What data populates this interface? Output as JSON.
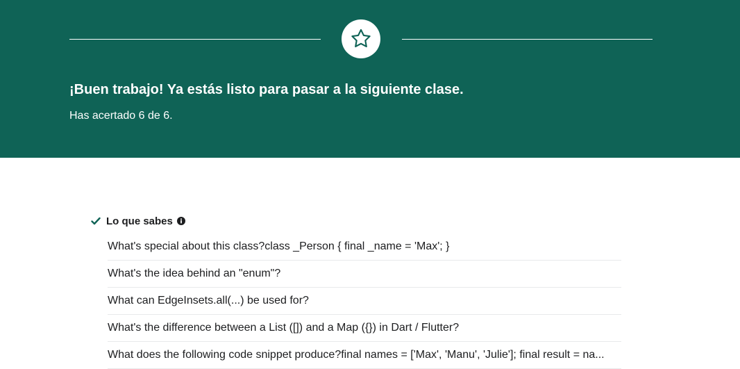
{
  "banner": {
    "headline": "¡Buen trabajo! Ya estás listo para pasar a la siguiente clase.",
    "score_text": "Has acertado 6 de 6.",
    "background_color": "#0f6356",
    "icon": "star-icon"
  },
  "knowledge_section": {
    "title": "Lo que sabes",
    "status_icon": "check-icon",
    "info_icon": "info-icon",
    "accent_color": "#0f6356",
    "questions": [
      "What's special about this class?class _Person { final _name = 'Max'; }",
      "What's the idea behind an \"enum\"?",
      "What can EdgeInsets.all(...) be used for?",
      "What's the difference between a List ([]) and a Map ({}) in Dart / Flutter?",
      "What does the following code snippet produce?final names = ['Max', 'Manu', 'Julie']; final result = na..."
    ]
  }
}
